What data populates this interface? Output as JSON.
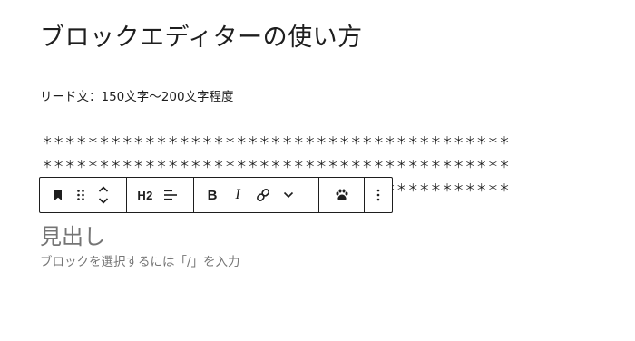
{
  "post": {
    "title": "ブロックエディターの使い方",
    "lead": "リード文：150文字〜200文字程度",
    "stars_line_1": "＊＊＊＊＊＊＊＊＊＊＊＊＊＊＊＊＊＊＊＊＊＊＊＊＊＊＊＊＊＊＊＊＊＊＊＊＊＊＊＊＊",
    "stars_line_2": "＊＊＊＊＊＊＊＊＊＊＊＊＊＊＊＊＊＊＊＊＊＊＊＊＊＊＊＊＊＊＊＊＊＊＊＊＊＊＊＊＊",
    "stars_line_3": "＊＊＊＊＊＊＊＊＊＊＊＊＊＊＊＊＊＊＊＊＊＊＊＊＊＊＊＊＊＊＊＊＊＊＊＊＊＊＊＊＊",
    "heading_placeholder": "見出し",
    "appender_placeholder": "ブロックを選択するには「/」を入力"
  },
  "toolbar": {
    "block_icon": "bookmark-icon",
    "drag_icon": "drag-handle-icon",
    "move_icon": "chevron-up-down-icon",
    "heading_level": "H2",
    "align_icon": "align-left-icon",
    "bold_label": "B",
    "italic_label": "I",
    "link_icon": "link-icon",
    "more_rich_text_icon": "chevron-down-icon",
    "plugin_icon": "paw-icon",
    "options_icon": "more-vertical-icon"
  }
}
